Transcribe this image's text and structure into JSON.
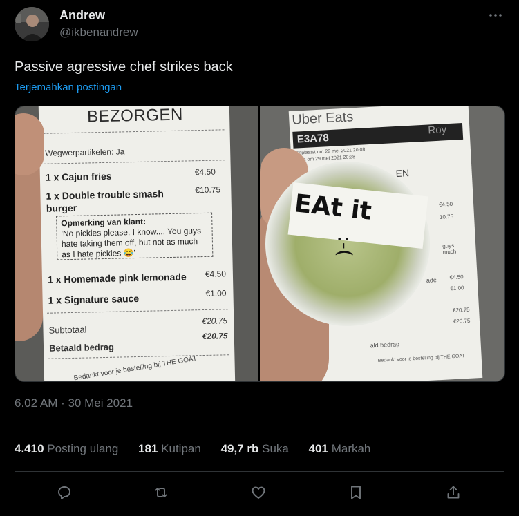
{
  "author": {
    "name": "Andrew",
    "handle": "@ikbenandrew"
  },
  "tweet": {
    "text": "Passive agressive chef strikes back",
    "translate_link": "Terjemahkan postingan",
    "timestamp": "6.02 AM · 30 Mei 2021"
  },
  "receipt1": {
    "title": "BEZORGEN",
    "packaging": "Wegwerpartikelen: Ja",
    "items": [
      {
        "name": "1 x Cajun fries",
        "price": "€4.50"
      },
      {
        "name": "1 x Double trouble smash burger",
        "price": "€10.75"
      },
      {
        "name": "1 x Homemade pink lemonade",
        "price": "€4.50"
      },
      {
        "name": "1 x Signature sauce",
        "price": "€1.00"
      }
    ],
    "note_title": "Opmerking van klant:",
    "note_text": "'No pickles please. I know.... You guys hate taking them off, but not as much as I hate pickles 😂'",
    "subtotal_label": "Subtotaal",
    "subtotal": "€20.75",
    "paid_label": "Betaald bedrag",
    "paid": "€20.75",
    "footer": "Bedankt voor je bestelling bij THE GOAT"
  },
  "receipt2": {
    "brand": "Uber Eats",
    "order_code": "E3A78",
    "courier": "Roy",
    "placed": "Geplaatst om 29 mei 2021 20:08",
    "delivered": "...eld om 29 mei 2021 20:38",
    "partial": "EN",
    "note_partial": "guys much",
    "item_partial": "ade",
    "prices": [
      "€4.50",
      "10.75",
      "€4.50",
      "€1.00",
      "€20.75",
      "€20.75"
    ],
    "paid_partial": "ald bedrag",
    "footer": "Bedankt voor je bestelling bij THE GOAT",
    "label_text": "EAt it",
    "face": ":-("
  },
  "stats": {
    "reposts_count": "4.410",
    "reposts_label": "Posting ulang",
    "quotes_count": "181",
    "quotes_label": "Kutipan",
    "likes_count": "49,7 rb",
    "likes_label": "Suka",
    "bookmarks_count": "401",
    "bookmarks_label": "Markah"
  },
  "icons": {
    "more": "more-icon",
    "reply": "reply-icon",
    "repost": "repost-icon",
    "like": "heart-icon",
    "bookmark": "bookmark-icon",
    "share": "share-icon"
  },
  "colors": {
    "background": "#000000",
    "text": "#e7e9ea",
    "muted": "#71767b",
    "link": "#1d9bf0",
    "border": "#2f3336"
  }
}
